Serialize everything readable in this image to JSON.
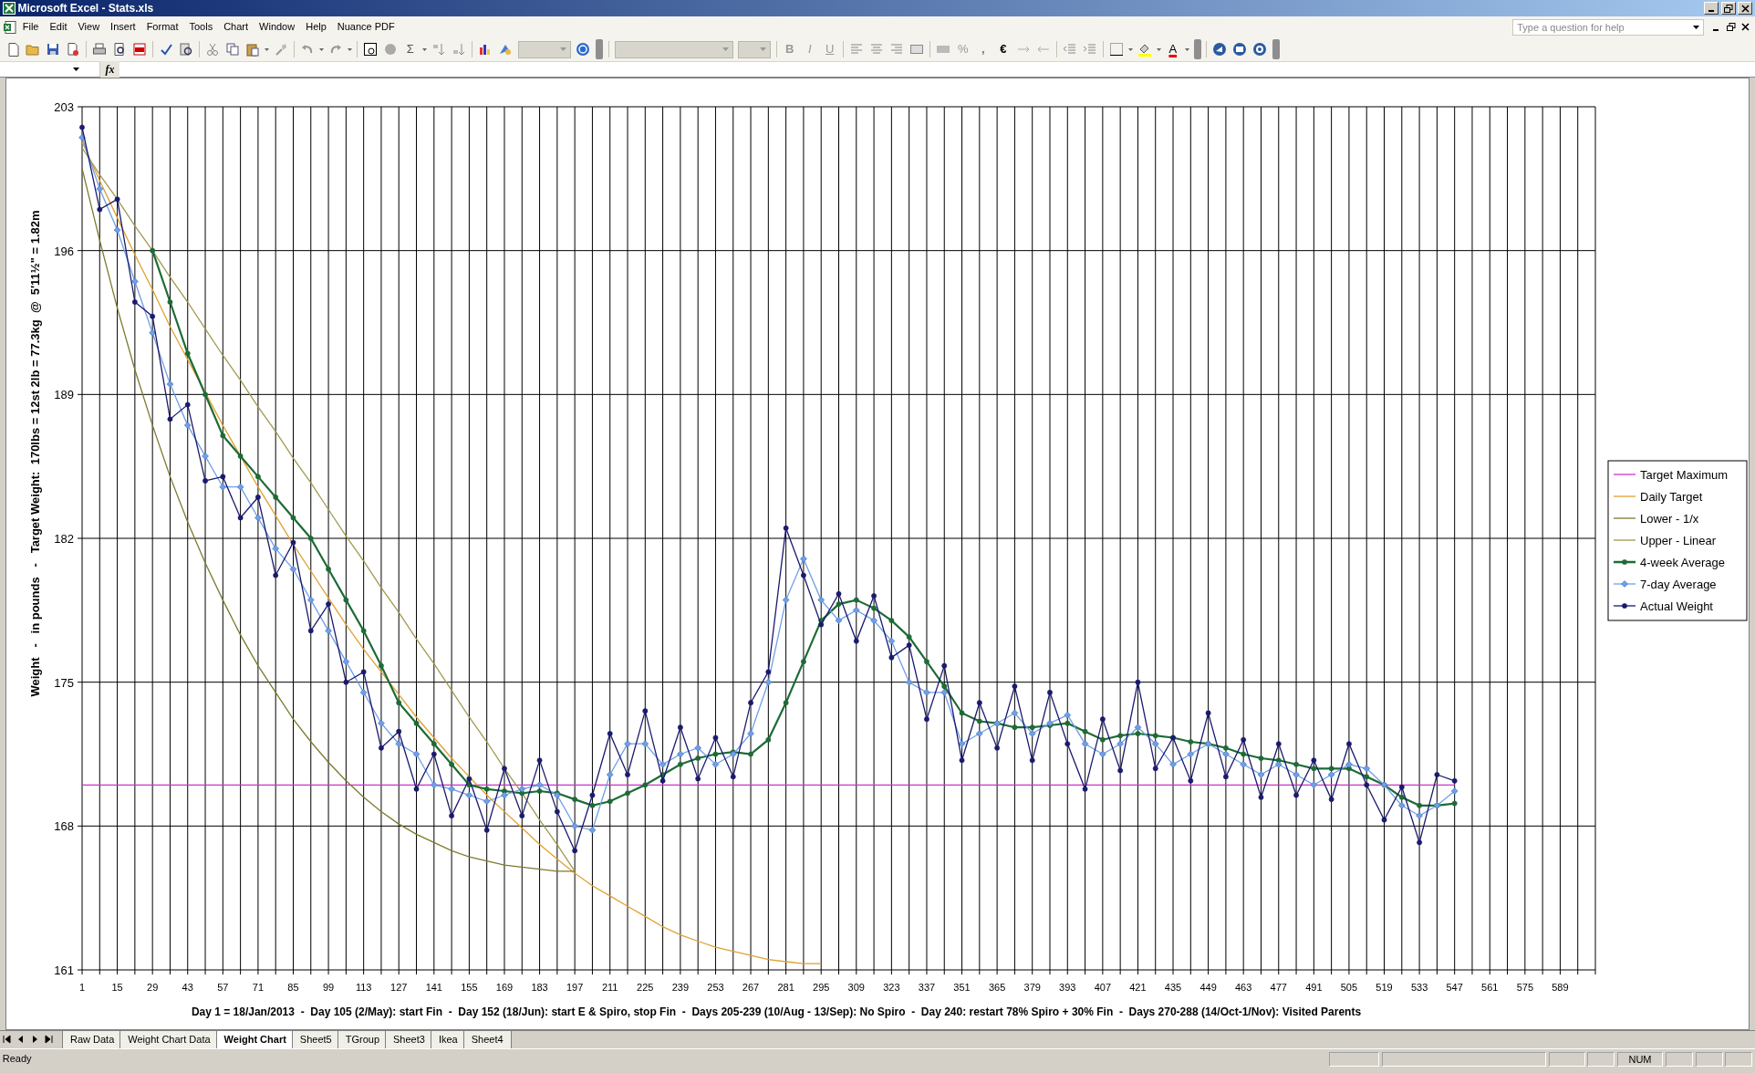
{
  "window": {
    "title": "Microsoft Excel - Stats.xls"
  },
  "menu": [
    "File",
    "Edit",
    "View",
    "Insert",
    "Format",
    "Tools",
    "Chart",
    "Window",
    "Help",
    "Nuance PDF"
  ],
  "help_box": {
    "placeholder": "Type a question for help"
  },
  "toolbar": {
    "glyph_buttons": [
      "Σ",
      "B",
      "I",
      "U",
      "%",
      ",",
      "€",
      "A"
    ],
    "combos": [
      {
        "disabled": true
      },
      {
        "disabled": true
      },
      {
        "disabled": true
      }
    ]
  },
  "formula_bar": {
    "fx": "fx"
  },
  "chart": {
    "chart_data": {
      "type": "line",
      "grid": true,
      "legend": true,
      "xlabel": "Day 1 = 18/Jan/2013  -  Day 105 (2/May): start Fin  -  Day 152 (18/Jun): start E & Spiro, stop Fin  -  Days 205-239 (10/Aug - 13/Sep): No Spiro  -  Day 240: restart 78% Spiro + 30% Fin  -  Days 270-288 (14/Oct-1/Nov): Visited Parents",
      "ylabel": "Weight   -   in pounds   -   Target Weight:  170lbs = 12st 2lb = 77.3kg  @  5'11½\" = 1.82m",
      "xlim": [
        1,
        603
      ],
      "ylim": [
        161,
        203
      ],
      "xticks": [
        1,
        15,
        29,
        43,
        57,
        71,
        85,
        99,
        113,
        127,
        141,
        155,
        169,
        183,
        197,
        211,
        225,
        239,
        253,
        267,
        281,
        295,
        309,
        323,
        337,
        351,
        365,
        379,
        393,
        407,
        421,
        435,
        449,
        463,
        477,
        491,
        505,
        519,
        533,
        547,
        561,
        575,
        589
      ],
      "yticks": [
        161,
        168,
        175,
        182,
        189,
        196,
        203
      ],
      "x": [
        1,
        8,
        15,
        22,
        29,
        36,
        43,
        50,
        57,
        64,
        71,
        78,
        85,
        92,
        99,
        106,
        113,
        120,
        127,
        134,
        141,
        148,
        155,
        162,
        169,
        176,
        183,
        190,
        197,
        204,
        211,
        218,
        225,
        232,
        239,
        246,
        253,
        260,
        267,
        274,
        281,
        288,
        295,
        302,
        309,
        316,
        323,
        330,
        337,
        344,
        351,
        358,
        365,
        372,
        379,
        386,
        393,
        400,
        407,
        414,
        421,
        428,
        435,
        442,
        449,
        456,
        463,
        470,
        477,
        484,
        491,
        498,
        505,
        512,
        519,
        526,
        533,
        540,
        547
      ],
      "series": [
        {
          "name": "Target Maximum",
          "color": "#cc33cc",
          "marker": "none",
          "values": [
            170,
            170,
            170,
            170,
            170,
            170,
            170,
            170,
            170,
            170,
            170,
            170,
            170,
            170,
            170,
            170,
            170,
            170,
            170,
            170,
            170,
            170,
            170,
            170,
            170,
            170,
            170,
            170,
            170,
            170,
            170,
            170,
            170,
            170,
            170,
            170,
            170,
            170,
            170,
            170,
            170,
            170,
            170,
            170,
            170,
            170,
            170,
            170,
            170,
            170,
            170,
            170,
            170,
            170,
            170,
            170,
            170,
            170,
            170,
            170,
            170,
            170,
            170,
            170,
            170,
            170,
            170,
            170,
            170,
            170,
            170,
            170,
            170,
            170,
            170,
            170,
            170,
            170,
            170
          ]
        },
        {
          "name": "Daily Target",
          "color": "#e0a030",
          "marker": "none",
          "values": [
            201.3,
            199.4,
            197.6,
            195.8,
            194.1,
            192.3,
            190.7,
            189.1,
            187.5,
            186.0,
            184.5,
            183.1,
            181.7,
            180.4,
            179.1,
            177.8,
            176.6,
            175.5,
            174.4,
            173.3,
            172.3,
            171.3,
            170.4,
            169.5,
            168.7,
            167.9,
            167.1,
            166.4,
            165.7,
            165.1,
            164.6,
            164.1,
            163.6,
            163.1,
            162.7,
            162.4,
            162.1,
            161.9,
            161.7,
            161.5,
            161.4,
            161.3,
            161.3,
            null,
            null,
            null,
            null,
            null,
            null,
            null,
            null,
            null,
            null,
            null,
            null,
            null,
            null,
            null,
            null,
            null,
            null,
            null,
            null,
            null,
            null,
            null,
            null,
            null,
            null,
            null,
            null,
            null,
            null,
            null,
            null,
            null,
            null,
            null,
            null
          ]
        },
        {
          "name": "Lower - 1/x",
          "color": "#7d7a2e",
          "marker": "none",
          "values": [
            200,
            196.5,
            193.2,
            190.2,
            187.5,
            185,
            182.8,
            180.8,
            179,
            177.3,
            175.8,
            174.5,
            173.2,
            172.1,
            171.1,
            170.2,
            169.4,
            168.7,
            168.1,
            167.6,
            167.2,
            166.8,
            166.5,
            166.3,
            166.1,
            166,
            165.9,
            165.8,
            165.8,
            null,
            null,
            null,
            null,
            null,
            null,
            null,
            null,
            null,
            null,
            null,
            null,
            null,
            null,
            null,
            null,
            null,
            null,
            null,
            null,
            null,
            null,
            null,
            null,
            null,
            null,
            null,
            null,
            null,
            null,
            null,
            null,
            null,
            null,
            null,
            null,
            null,
            null,
            null,
            null,
            null,
            null,
            null,
            null,
            null,
            null,
            null,
            null,
            null,
            null
          ]
        },
        {
          "name": "Upper - Linear",
          "color": "#a09a50",
          "marker": "none",
          "values": [
            201,
            199.7,
            198.5,
            197.2,
            196,
            194.7,
            193.5,
            192.2,
            190.9,
            189.7,
            188.4,
            187.2,
            185.9,
            184.7,
            183.4,
            182.1,
            180.9,
            179.6,
            178.4,
            177.1,
            175.9,
            174.6,
            173.3,
            172.1,
            170.8,
            169.6,
            168.3,
            167.1,
            165.8,
            null,
            null,
            null,
            null,
            null,
            null,
            null,
            null,
            null,
            null,
            null,
            null,
            null,
            null,
            null,
            null,
            null,
            null,
            null,
            null,
            null,
            null,
            null,
            null,
            null,
            null,
            null,
            null,
            null,
            null,
            null,
            null,
            null,
            null,
            null,
            null,
            null,
            null,
            null,
            null,
            null,
            null,
            null,
            null,
            null,
            null,
            null,
            null,
            null,
            null
          ]
        },
        {
          "name": "4-week Average",
          "color": "#1d6b35",
          "marker": "circle",
          "values": [
            null,
            null,
            null,
            null,
            196,
            193.5,
            191,
            189,
            187,
            186,
            185,
            184,
            183,
            182,
            180.5,
            179,
            177.5,
            175.8,
            174,
            173,
            172,
            171,
            170,
            169.8,
            169.7,
            169.6,
            169.7,
            169.6,
            169.3,
            169,
            169.2,
            169.6,
            170,
            170.5,
            171,
            171.3,
            171.5,
            171.6,
            171.5,
            172.2,
            174,
            176,
            178,
            178.8,
            179,
            178.6,
            178,
            177.2,
            176,
            174.8,
            173.5,
            173.1,
            173,
            172.8,
            172.8,
            172.9,
            173,
            172.6,
            172.2,
            172.4,
            172.5,
            172.4,
            172.3,
            172.1,
            172,
            171.8,
            171.5,
            171.3,
            171.2,
            171,
            170.8,
            170.8,
            170.8,
            170.4,
            170,
            169.4,
            169,
            169,
            169.1
          ]
        },
        {
          "name": "7-day Average",
          "color": "#6f9fe6",
          "marker": "diamond",
          "values": [
            201.5,
            199,
            197,
            194.5,
            192,
            189.5,
            187.5,
            186,
            184.5,
            184.5,
            183,
            181.5,
            180.5,
            179,
            177.5,
            176,
            174.5,
            173,
            172,
            171.5,
            170,
            169.8,
            169.5,
            169.2,
            169.5,
            169.8,
            170,
            169.5,
            168,
            167.8,
            170.5,
            172,
            172,
            171,
            171.5,
            171.8,
            171,
            171.5,
            172.5,
            175,
            179,
            181,
            179,
            178,
            178.5,
            178,
            177,
            175,
            174.5,
            174.5,
            172,
            172.5,
            173,
            173.5,
            172.5,
            173,
            173.4,
            172,
            171.5,
            172,
            172.8,
            172,
            171,
            171.5,
            172,
            171.5,
            171,
            170.5,
            171,
            170.5,
            170,
            170.5,
            171,
            170.8,
            170,
            169,
            168.5,
            169,
            169.7
          ]
        },
        {
          "name": "Actual Weight",
          "color": "#1a1a6e",
          "marker": "circle",
          "values": [
            202,
            198,
            198.5,
            193.5,
            192.8,
            187.8,
            188.5,
            184.8,
            185,
            183,
            184,
            180.2,
            181.8,
            177.5,
            178.8,
            175,
            175.5,
            171.8,
            172.6,
            169.8,
            171.5,
            168.5,
            170.3,
            167.8,
            170.8,
            168.5,
            171.2,
            168.7,
            166.8,
            169.5,
            172.5,
            170.5,
            173.6,
            170.2,
            172.8,
            170.3,
            172.3,
            170.4,
            174,
            175.5,
            182.5,
            180.2,
            177.8,
            179.3,
            177,
            179.2,
            176.2,
            176.8,
            173.2,
            175.8,
            171.2,
            174,
            171.8,
            174.8,
            171.2,
            174.5,
            172,
            169.8,
            173.2,
            170.7,
            175,
            170.8,
            172.3,
            170.2,
            173.5,
            170.4,
            172.2,
            169.4,
            172,
            169.5,
            171.2,
            169.3,
            172,
            170,
            168.3,
            169.9,
            167.2,
            170.5,
            170.2
          ]
        }
      ]
    }
  },
  "sheet_tabs": [
    {
      "label": "Raw Data",
      "selected": false
    },
    {
      "label": "Weight Chart Data",
      "selected": false
    },
    {
      "label": "Weight Chart",
      "selected": true
    },
    {
      "label": "Sheet5",
      "selected": false
    },
    {
      "label": "TGroup",
      "selected": false
    },
    {
      "label": "Sheet3",
      "selected": false
    },
    {
      "label": "Ikea",
      "selected": false
    },
    {
      "label": "Sheet4",
      "selected": false
    }
  ],
  "status_bar": {
    "message": "Ready",
    "indicator": "NUM"
  }
}
